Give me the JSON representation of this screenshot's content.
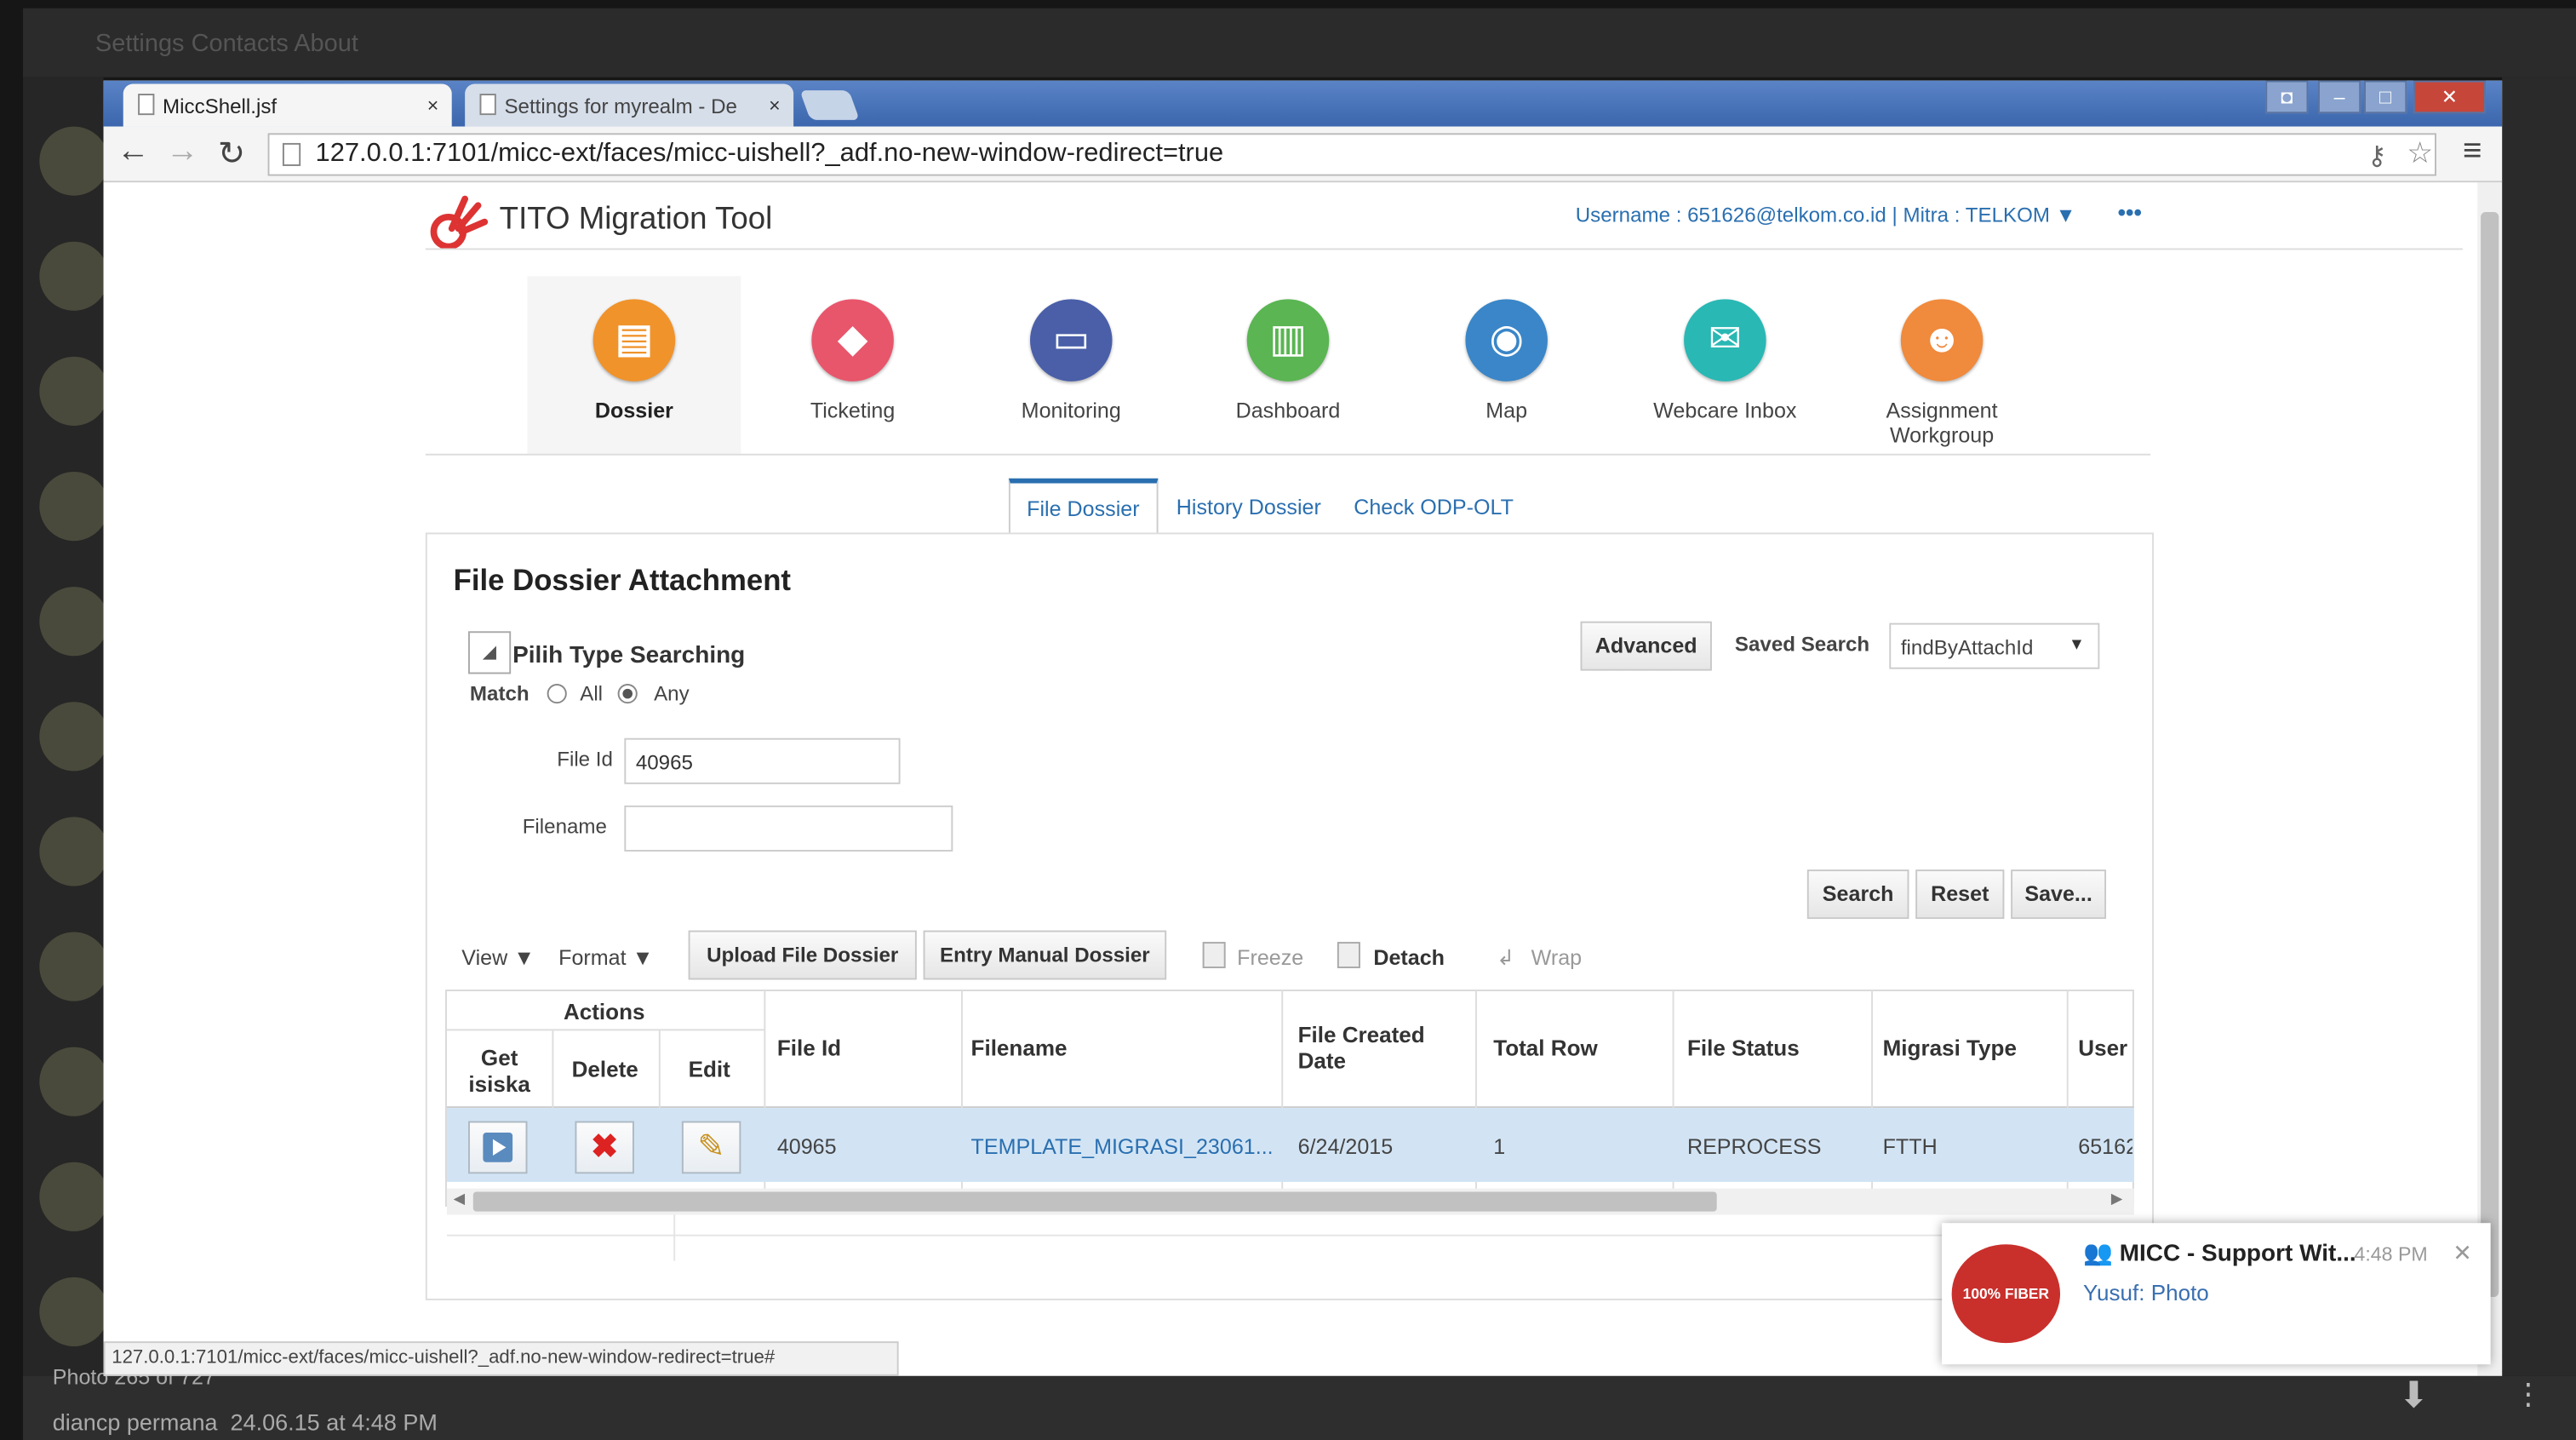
{
  "viewer": {
    "top_menu": "Settings   Contacts   About",
    "photo_counter": "Photo 265 of 727",
    "author": "diancp permana",
    "timestamp": "24.06.15 at 4:48 PM"
  },
  "browser": {
    "tabs": [
      {
        "title": "MiccShell.jsf",
        "close": "×"
      },
      {
        "title": "Settings for myrealm - De",
        "close": "×"
      }
    ],
    "url": "127.0.0.1:7101/micc-ext/faces/micc-uishell?_adf.no-new-window-redirect=true",
    "status_url": "127.0.0.1:7101/micc-ext/faces/micc-uishell?_adf.no-new-window-redirect=true#"
  },
  "app": {
    "name": "TITO Migration Tool",
    "user_info": "Username : 651626@telkom.co.id | Mitra : TELKOM",
    "nav": [
      {
        "label": "Dossier",
        "icon": "document-icon",
        "color": "#f0932b"
      },
      {
        "label": "Ticketing",
        "icon": "tag-icon",
        "color": "#e8566c"
      },
      {
        "label": "Monitoring",
        "icon": "monitor-icon",
        "color": "#4a5fa8"
      },
      {
        "label": "Dashboard",
        "icon": "bar-chart-icon",
        "color": "#5ab552"
      },
      {
        "label": "Map",
        "icon": "map-icon",
        "color": "#3a86c8"
      },
      {
        "label": "Webcare Inbox",
        "icon": "envelope-icon",
        "color": "#29b8b4"
      },
      {
        "label": "Assignment Workgroup",
        "icon": "group-icon",
        "color": "#f08a3c"
      }
    ],
    "subtabs": [
      "File Dossier",
      "History Dossier",
      "Check ODP-OLT"
    ]
  },
  "search_panel": {
    "title": "File Dossier Attachment",
    "section_label": "Pilih Type Searching",
    "match_label": "Match",
    "match_options": [
      "All",
      "Any"
    ],
    "match_selected": "Any",
    "advanced_label": "Advanced",
    "saved_search_label": "Saved Search",
    "saved_search_value": "findByAttachId",
    "fields": {
      "file_id": {
        "label": "File Id",
        "value": "40965"
      },
      "filename": {
        "label": "Filename",
        "value": ""
      }
    },
    "buttons": {
      "search": "Search",
      "reset": "Reset",
      "save": "Save..."
    }
  },
  "table_toolbar": {
    "view": "View",
    "format": "Format",
    "upload": "Upload File Dossier",
    "entry": "Entry Manual Dossier",
    "freeze": "Freeze",
    "detach": "Detach",
    "wrap": "Wrap"
  },
  "table": {
    "group_header": "Actions",
    "action_headers": [
      "Get isiska",
      "Delete",
      "Edit"
    ],
    "headers": [
      "File Id",
      "Filename",
      "File Created Date",
      "Total Row",
      "File Status",
      "Migrasi Type",
      "User"
    ],
    "rows": [
      {
        "file_id": "40965",
        "filename": "TEMPLATE_MIGRASI_23061...",
        "created": "6/24/2015",
        "total_row": "1",
        "status": "REPROCESS",
        "type": "FTTH",
        "user": "65162"
      }
    ]
  },
  "notification": {
    "badge": "100% FIBER",
    "title": "MICC - Support Wit...",
    "time": "4:48 PM",
    "message": "Yusuf: Photo"
  }
}
